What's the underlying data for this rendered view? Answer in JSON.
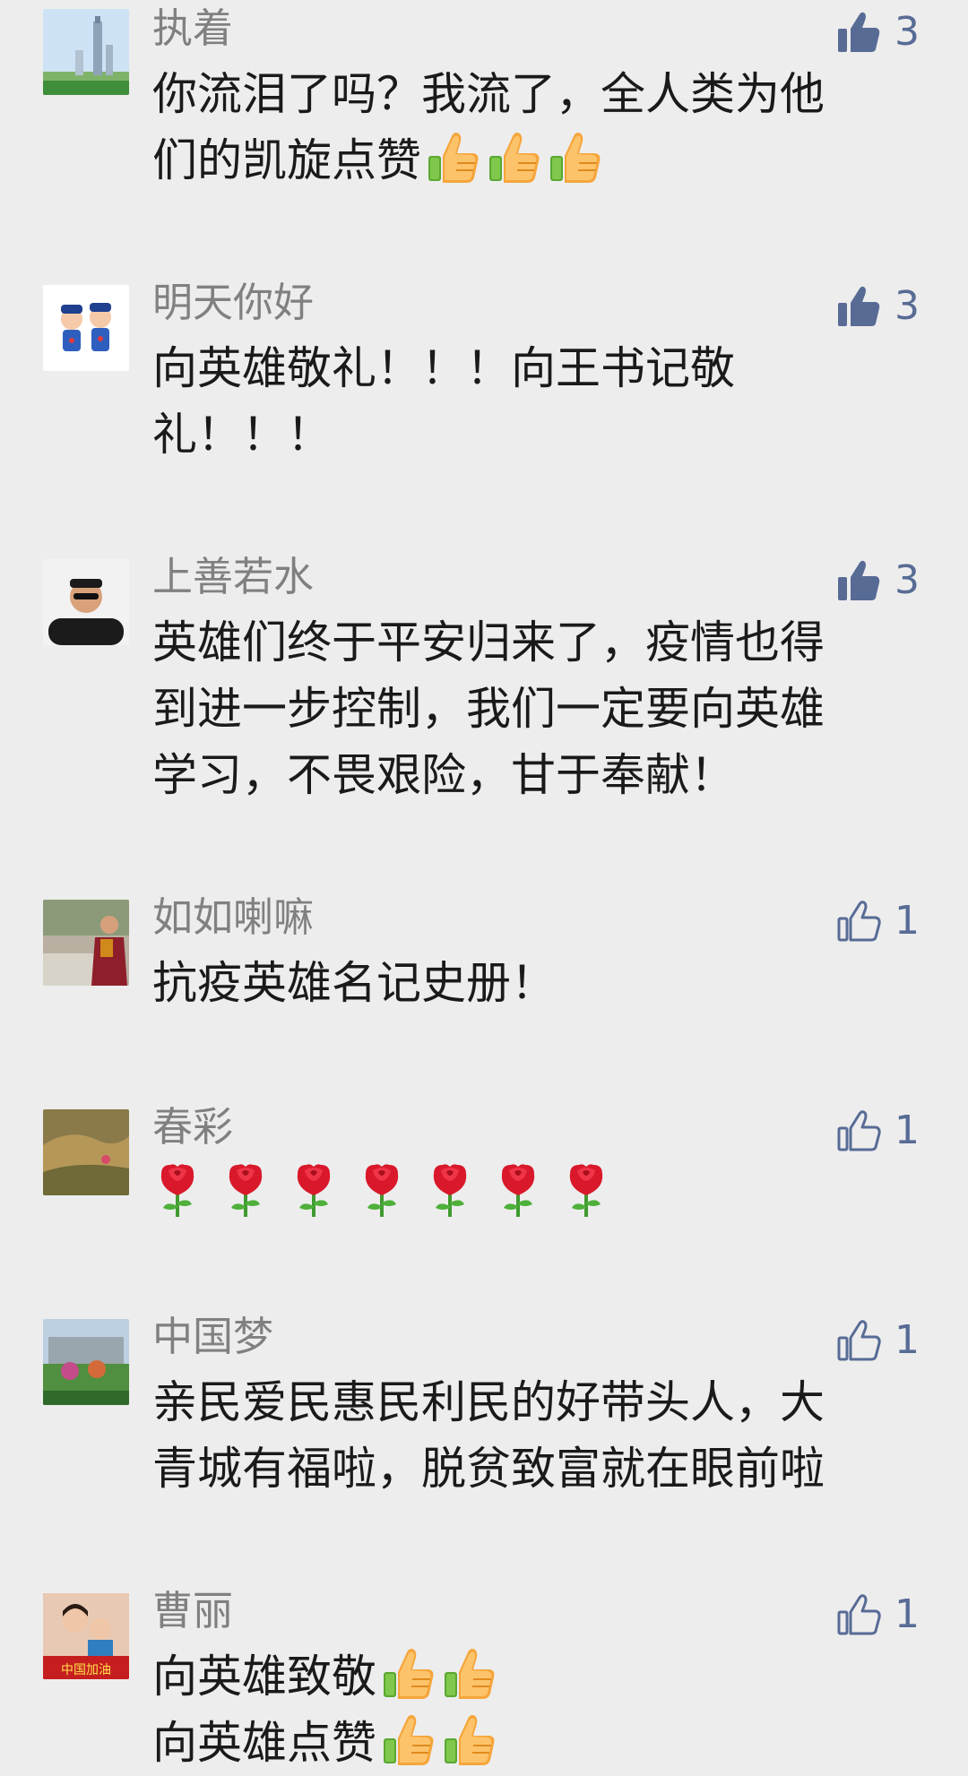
{
  "colors": {
    "background": "#ededed",
    "nickname": "#808080",
    "text": "#1a1a1a",
    "like": "#576b95"
  },
  "comments": [
    {
      "nickname": "执着",
      "lines": [
        "你流泪了吗？我流了，全人类为他",
        "们的凯旋点赞"
      ],
      "emoji": [
        "thumbs-up-emoji",
        "thumbs-up-emoji",
        "thumbs-up-emoji"
      ],
      "likes": "3",
      "liked": true
    },
    {
      "nickname": "明天你好",
      "lines": [
        "向英雄敬礼！！！向王书记敬",
        "礼！！！"
      ],
      "likes": "3",
      "liked": true
    },
    {
      "nickname": "上善若水",
      "lines": [
        "英雄们终于平安归来了，疫情也得",
        "到进一步控制，我们一定要向英雄",
        "学习，不畏艰险，甘于奉献！"
      ],
      "likes": "3",
      "liked": true
    },
    {
      "nickname": "如如喇嘛",
      "lines": [
        "抗疫英雄名记史册！"
      ],
      "likes": "1",
      "liked": false
    },
    {
      "nickname": "春彩",
      "lines": [],
      "emoji": [
        "rose-emoji",
        "rose-emoji",
        "rose-emoji",
        "rose-emoji",
        "rose-emoji",
        "rose-emoji",
        "rose-emoji"
      ],
      "likes": "1",
      "liked": false
    },
    {
      "nickname": "中国梦",
      "lines": [
        "亲民爱民惠民利民的好带头人，大",
        "青城有福啦，脱贫致富就在眼前啦"
      ],
      "likes": "1",
      "liked": false
    },
    {
      "nickname": "曹丽",
      "lines": [
        "向英雄致敬",
        "向英雄点赞"
      ],
      "emoji": [
        "thumbs-up-emoji",
        "thumbs-up-emoji"
      ],
      "likes": "1",
      "liked": false,
      "avatar_text": "中国加油"
    }
  ]
}
